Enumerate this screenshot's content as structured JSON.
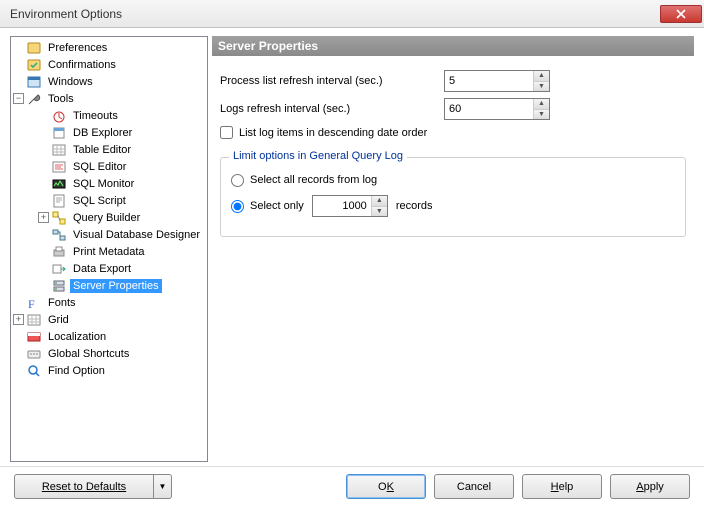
{
  "window": {
    "title": "Environment Options"
  },
  "tree": {
    "items": [
      {
        "label": "Preferences",
        "toggle": "",
        "indent": 1,
        "icon": "prefs"
      },
      {
        "label": "Confirmations",
        "toggle": "",
        "indent": 1,
        "icon": "confirm"
      },
      {
        "label": "Windows",
        "toggle": "",
        "indent": 1,
        "icon": "windows"
      },
      {
        "label": "Tools",
        "toggle": "−",
        "indent": 1,
        "icon": "tools"
      },
      {
        "label": "Timeouts",
        "toggle": "",
        "indent": 2,
        "icon": "timeouts"
      },
      {
        "label": "DB Explorer",
        "toggle": "",
        "indent": 2,
        "icon": "dbexp"
      },
      {
        "label": "Table Editor",
        "toggle": "",
        "indent": 2,
        "icon": "tableed"
      },
      {
        "label": "SQL Editor",
        "toggle": "",
        "indent": 2,
        "icon": "sqled"
      },
      {
        "label": "SQL Monitor",
        "toggle": "",
        "indent": 2,
        "icon": "sqlmon"
      },
      {
        "label": "SQL Script",
        "toggle": "",
        "indent": 2,
        "icon": "sqlscript"
      },
      {
        "label": "Query Builder",
        "toggle": "+",
        "indent": 2,
        "icon": "qbuilder"
      },
      {
        "label": "Visual Database Designer",
        "toggle": "",
        "indent": 2,
        "icon": "vdd"
      },
      {
        "label": "Print Metadata",
        "toggle": "",
        "indent": 2,
        "icon": "print"
      },
      {
        "label": "Data Export",
        "toggle": "",
        "indent": 2,
        "icon": "export"
      },
      {
        "label": "Server Properties",
        "toggle": "",
        "indent": 2,
        "icon": "server",
        "selected": true
      },
      {
        "label": "Fonts",
        "toggle": "",
        "indent": 1,
        "icon": "fonts"
      },
      {
        "label": "Grid",
        "toggle": "+",
        "indent": 1,
        "icon": "grid"
      },
      {
        "label": "Localization",
        "toggle": "",
        "indent": 1,
        "icon": "local"
      },
      {
        "label": "Global Shortcuts",
        "toggle": "",
        "indent": 1,
        "icon": "shortcuts"
      },
      {
        "label": "Find Option",
        "toggle": "",
        "indent": 1,
        "icon": "find"
      }
    ]
  },
  "header": {
    "title": "Server Properties"
  },
  "form": {
    "process_label": "Process list refresh interval (sec.)",
    "process_value": "5",
    "logs_label": "Logs refresh interval (sec.)",
    "logs_value": "60",
    "desc_check_label": "List log items in descending date order"
  },
  "group": {
    "legend": "Limit options in General Query Log",
    "radio_all": "Select all records from log",
    "radio_only": "Select only",
    "only_value": "1000",
    "records_suffix": "records"
  },
  "buttons": {
    "reset": "Reset to Defaults",
    "ok_pre": "O",
    "ok_u": "K",
    "cancel": "Cancel",
    "help_u": "H",
    "help_rest": "elp",
    "apply_u": "A",
    "apply_rest": "pply"
  }
}
